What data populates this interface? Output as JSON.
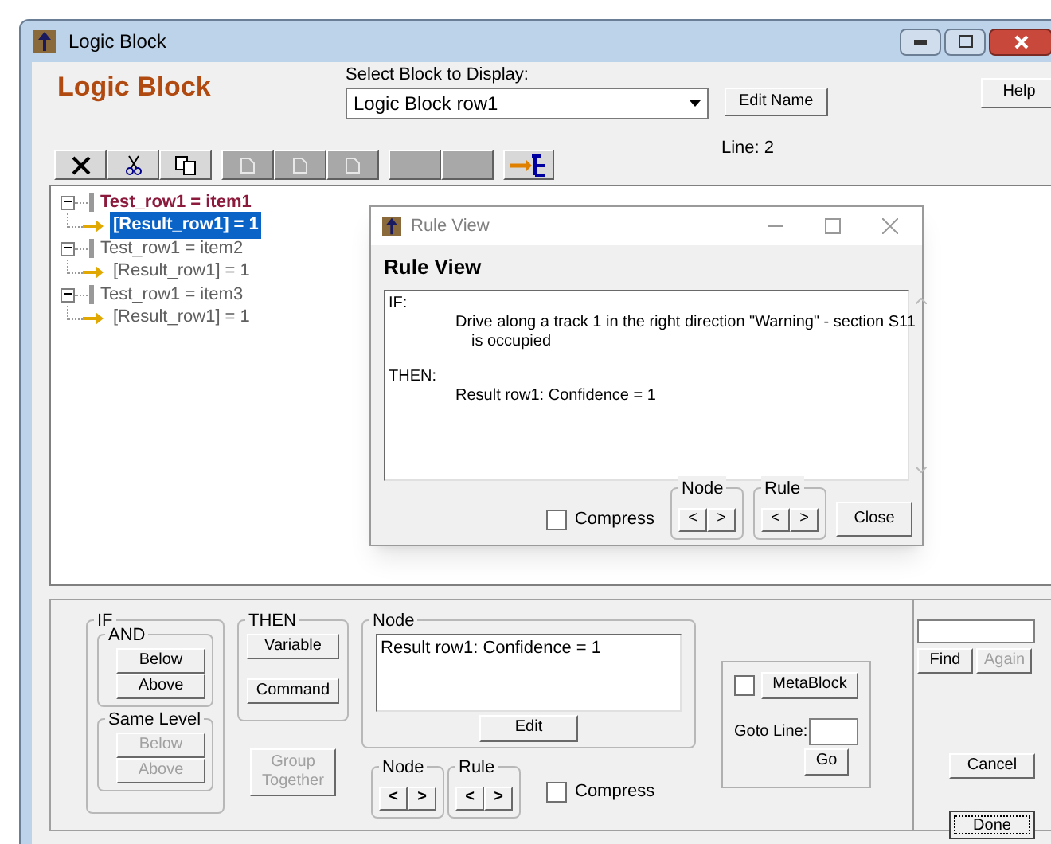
{
  "window": {
    "title": "Logic Block"
  },
  "header": {
    "heading": "Logic Block",
    "select_label": "Select Block to Display:",
    "select_value": "Logic Block row1",
    "edit_name": "Edit Name",
    "help": "Help",
    "line": "Line: 2"
  },
  "toolbar": [
    {
      "kind": "delete",
      "disabled": false
    },
    {
      "kind": "cut",
      "disabled": false
    },
    {
      "kind": "copy",
      "disabled": false
    },
    {
      "kind": "doc",
      "disabled": true
    },
    {
      "kind": "doc",
      "disabled": true
    },
    {
      "kind": "doc",
      "disabled": true
    },
    {
      "kind": "blank",
      "disabled": true
    },
    {
      "kind": "blank",
      "disabled": true
    },
    {
      "kind": "tree",
      "disabled": false
    }
  ],
  "tree": [
    {
      "label": "Test_row1 = item1",
      "current": true,
      "expanded": true,
      "children": [
        {
          "label": "[Result_row1] = 1",
          "selected": true
        }
      ]
    },
    {
      "label": "Test_row1 = item2",
      "current": false,
      "expanded": true,
      "children": [
        {
          "label": "[Result_row1] = 1",
          "selected": false
        }
      ]
    },
    {
      "label": "Test_row1 = item3",
      "current": false,
      "expanded": true,
      "children": [
        {
          "label": "[Result_row1] = 1",
          "selected": false
        }
      ]
    }
  ],
  "rule_view": {
    "title": "Rule View",
    "heading": "Rule View",
    "if_label": "IF:",
    "if_text": "Drive along a track 1 in the right direction \"Warning\" - section S11",
    "if_text_cont": "is occupied",
    "then_label": "THEN:",
    "then_text": "Result row1: Confidence = 1",
    "compress": {
      "label": "Compress",
      "checked": false
    },
    "nav": [
      {
        "label": "Node",
        "prev": "<",
        "next": ">"
      },
      {
        "label": "Rule",
        "prev": "<",
        "next": ">"
      }
    ],
    "close": "Close"
  },
  "bottom": {
    "if_group": {
      "label": "IF",
      "and": {
        "label": "AND",
        "buttons": [
          {
            "label": "Below",
            "disabled": false
          },
          {
            "label": "Above",
            "disabled": false
          }
        ]
      },
      "same_level": {
        "label": "Same Level",
        "buttons": [
          {
            "label": "Below",
            "disabled": true
          },
          {
            "label": "Above",
            "disabled": true
          }
        ]
      }
    },
    "then_group": {
      "label": "THEN",
      "buttons": [
        {
          "label": "Variable",
          "disabled": false
        },
        {
          "label": "Command",
          "disabled": false
        }
      ]
    },
    "group_together": {
      "label": "Group Together",
      "disabled": true
    },
    "node": {
      "label": "Node",
      "text": "Result row1: Confidence = 1",
      "edit": "Edit"
    },
    "nav": [
      {
        "label": "Node",
        "prev": "<",
        "next": ">"
      },
      {
        "label": "Rule",
        "prev": "<",
        "next": ">"
      }
    ],
    "compress": {
      "label": "Compress",
      "checked": false
    },
    "metablock": {
      "label": "MetaBlock",
      "checked": false
    },
    "goto_label": "Goto Line:",
    "go": "Go",
    "find": "Find",
    "again": {
      "label": "Again",
      "disabled": true
    },
    "cancel": "Cancel",
    "done": "Done"
  }
}
